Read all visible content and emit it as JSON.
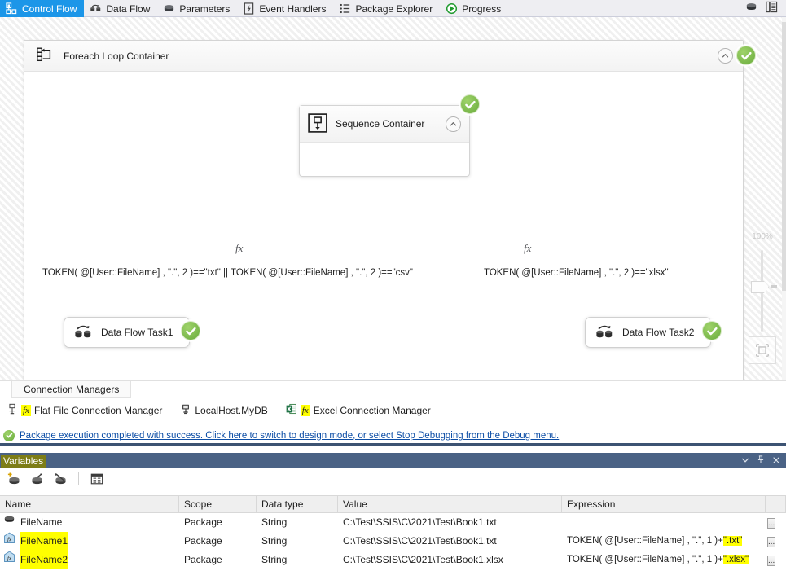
{
  "tabs": [
    {
      "label": "Control Flow",
      "icon": "control-flow-icon",
      "active": true
    },
    {
      "label": "Data Flow",
      "icon": "data-flow-icon",
      "active": false
    },
    {
      "label": "Parameters",
      "icon": "parameters-icon",
      "active": false
    },
    {
      "label": "Event Handlers",
      "icon": "event-handlers-icon",
      "active": false
    },
    {
      "label": "Package Explorer",
      "icon": "package-explorer-icon",
      "active": false
    },
    {
      "label": "Progress",
      "icon": "progress-icon",
      "active": false
    }
  ],
  "titlebar_icons": [
    "parameters-icon",
    "properties-icon"
  ],
  "canvas": {
    "foreach_container": {
      "title": "Foreach Loop Container",
      "status": "success"
    },
    "sequence_container": {
      "title": "Sequence Container",
      "status": "success"
    },
    "precedence_constraints": [
      {
        "fx_label": "fx",
        "expression": "TOKEN( @[User::FileName] , \".\", 2 )==\"txt\" || TOKEN( @[User::FileName] , \".\", 2 )==\"csv\""
      },
      {
        "fx_label": "fx",
        "expression": "TOKEN( @[User::FileName] , \".\", 2 )==\"xlsx\""
      }
    ],
    "tasks": [
      {
        "label": "Data Flow Task1",
        "status": "success",
        "warning": false
      },
      {
        "label": "Data Flow Task2",
        "status": "success",
        "warning": true
      }
    ],
    "zoom": {
      "level": "100%",
      "fit_label": "fit-to-window"
    }
  },
  "connection_managers": {
    "tab_label": "Connection Managers",
    "items": [
      {
        "label": "Flat File Connection Manager",
        "icon": "flat-file-icon",
        "has_expression": true,
        "fx": "fx"
      },
      {
        "label": "LocalHost.MyDB",
        "icon": "oledb-icon",
        "has_expression": false,
        "fx": ""
      },
      {
        "label": "Excel Connection Manager",
        "icon": "excel-icon",
        "has_expression": true,
        "fx": "fx"
      }
    ]
  },
  "status_bar": {
    "icon": "success-icon",
    "message": "Package execution completed with success. Click here to switch to design mode, or select Stop Debugging from the Debug menu."
  },
  "variables_panel": {
    "title": "Variables",
    "header_icons": [
      "chevron-down-icon",
      "pin-icon",
      "close-icon"
    ],
    "toolbar_buttons": [
      "add-variable-icon",
      "delete-variable-icon",
      "move-variable-icon",
      "grid-options-icon"
    ],
    "columns": [
      "Name",
      "Scope",
      "Data type",
      "Value",
      "Expression"
    ],
    "rows": [
      {
        "icon": "variable-icon",
        "name": "FileName",
        "name_highlighted": false,
        "scope": "Package",
        "data_type": "String",
        "value": "C:\\Test\\SSIS\\C\\2021\\Test\\Book1.txt",
        "expression_prefix": "",
        "expression_highlight": "",
        "ellipsis": "..."
      },
      {
        "icon": "variable-expression-icon",
        "name": "FileName1",
        "name_highlighted": true,
        "scope": "Package",
        "data_type": "String",
        "value": "C:\\Test\\SSIS\\C\\2021\\Test\\Book1.txt",
        "expression_prefix": "TOKEN( @[User::FileName] , \".\", 1 )+",
        "expression_highlight": "\".txt\"",
        "ellipsis": "..."
      },
      {
        "icon": "variable-expression-icon",
        "name": "FileName2",
        "name_highlighted": true,
        "scope": "Package",
        "data_type": "String",
        "value": "C:\\Test\\SSIS\\C\\2021\\Test\\Book1.xlsx",
        "expression_prefix": "TOKEN( @[User::FileName] , \".\", 1 )+",
        "expression_highlight": "\".xlsx\"",
        "ellipsis": "..."
      }
    ]
  },
  "colors": {
    "accent_tab": "#1c96e8",
    "success_green": "#69ab3c",
    "connector_green": "#5aa469",
    "panel_header": "#4a6285",
    "highlight_yellow": "#ffff00",
    "link_blue": "#0d4ea6",
    "warning_yellow": "#f0c419"
  }
}
